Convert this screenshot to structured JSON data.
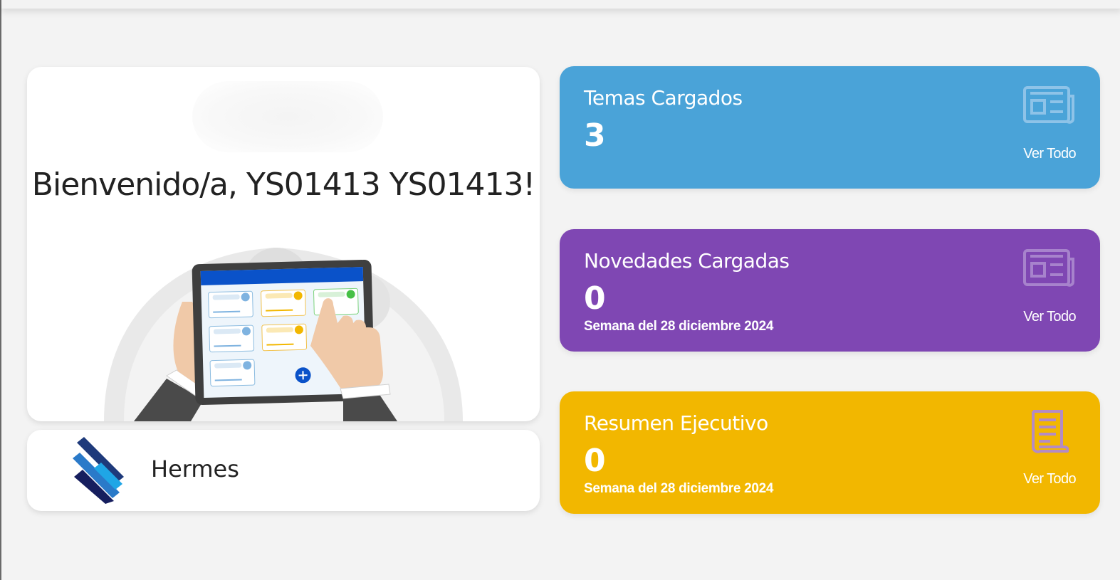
{
  "welcome": {
    "title": "Bienvenido/a, YS01413 YS01413!"
  },
  "brand": {
    "name": "Hermes"
  },
  "cards": [
    {
      "title": "Temas Cargados",
      "value": "3",
      "link_label": "Ver Todo",
      "icon": "newspaper-icon",
      "color": "#4aa3d8"
    },
    {
      "title": "Novedades Cargadas",
      "value": "0",
      "week": "Semana del 28 diciembre 2024",
      "link_label": "Ver Todo",
      "icon": "newspaper-icon",
      "color": "#7f47b3"
    },
    {
      "title": "Resumen Ejecutivo",
      "value": "0",
      "week": "Semana del 28 diciembre 2024",
      "link_label": "Ver Todo",
      "icon": "scroll-document-icon",
      "color": "#f2b700"
    }
  ],
  "colors": {
    "background": "#f3f3f3",
    "card": "#ffffff",
    "text": "#222222"
  }
}
